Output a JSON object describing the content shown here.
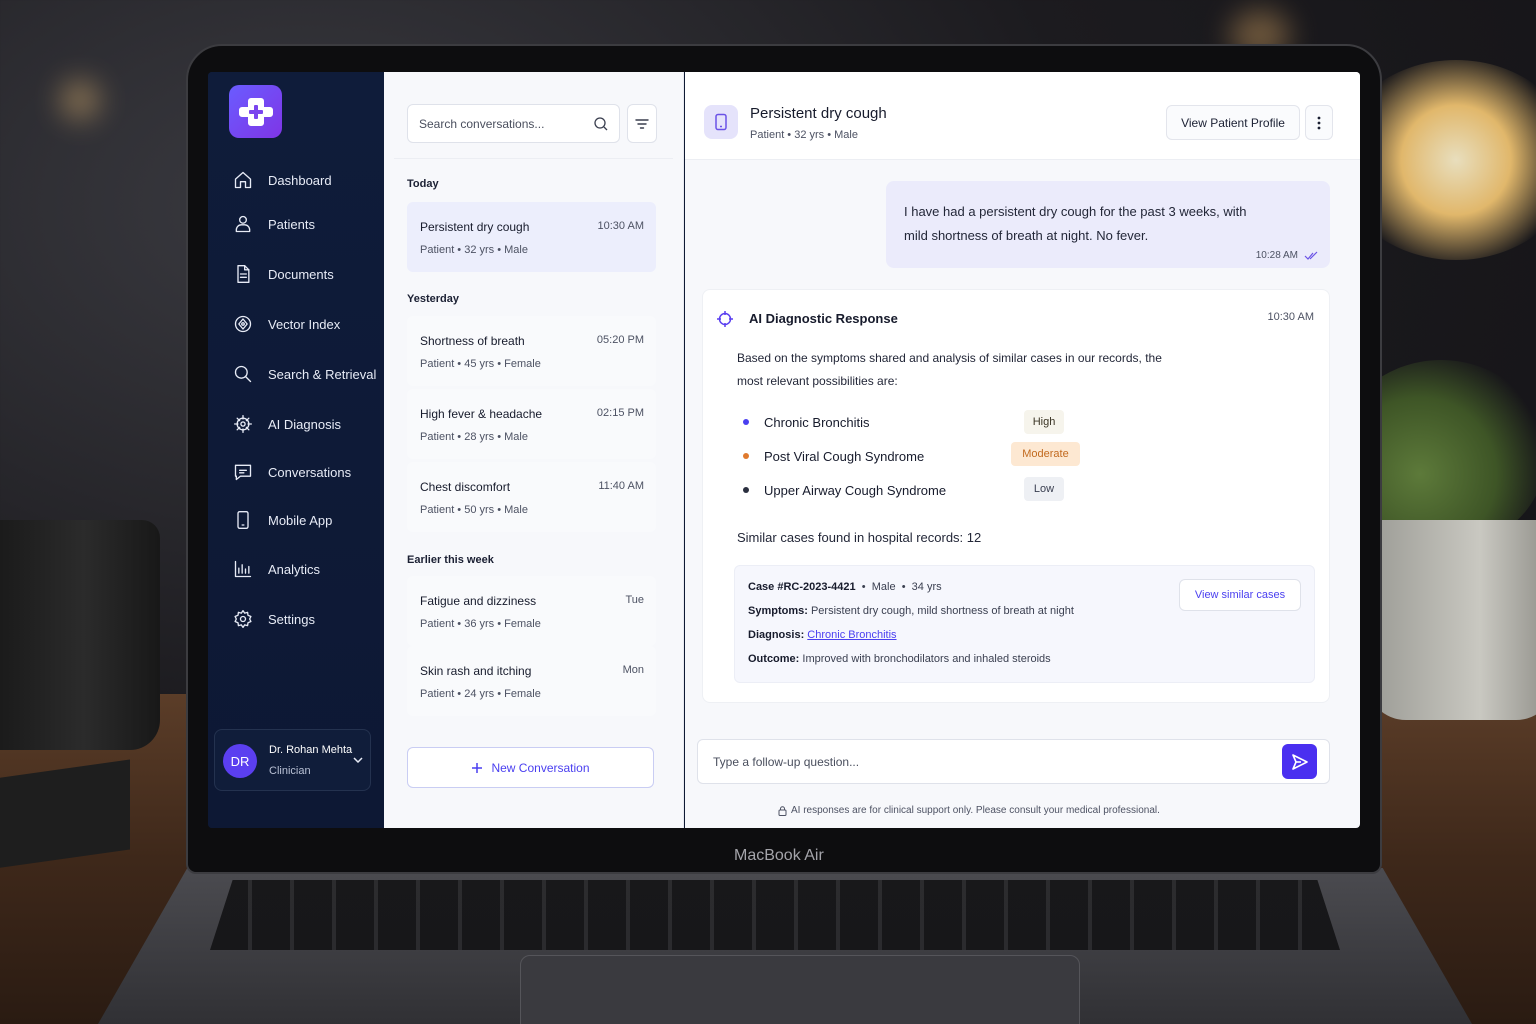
{
  "device": {
    "label": "MacBook Air"
  },
  "sidebar": {
    "items": [
      {
        "label": "Dashboard",
        "icon": "home-icon"
      },
      {
        "label": "Patients",
        "icon": "user-icon"
      },
      {
        "label": "Documents",
        "icon": "document-icon"
      },
      {
        "label": "Vector Index",
        "icon": "vector-icon"
      },
      {
        "label": "Search & Retrieval",
        "icon": "search-icon"
      },
      {
        "label": "AI Diagnosis",
        "icon": "brain-icon"
      },
      {
        "label": "Conversations",
        "icon": "chat-icon"
      },
      {
        "label": "Mobile App",
        "icon": "mobile-icon"
      },
      {
        "label": "Analytics",
        "icon": "chart-icon"
      },
      {
        "label": "Settings",
        "icon": "gear-icon"
      }
    ],
    "user": {
      "initials": "DR",
      "name": "Dr. Rohan Mehta",
      "role": "Clinician"
    }
  },
  "conversations": {
    "search_placeholder": "Search conversations...",
    "groups": [
      {
        "label": "Today",
        "items": [
          {
            "title": "Persistent dry cough",
            "time": "10:30 AM",
            "meta": "Patient • 32 yrs • Male",
            "active": true
          }
        ]
      },
      {
        "label": "Yesterday",
        "items": [
          {
            "title": "Shortness of breath",
            "time": "05:20 PM",
            "meta": "Patient • 45 yrs • Female"
          },
          {
            "title": "High fever & headache",
            "time": "02:15 PM",
            "meta": "Patient • 28 yrs • Male"
          },
          {
            "title": "Chest discomfort",
            "time": "11:40 AM",
            "meta": "Patient • 50 yrs • Male"
          }
        ]
      },
      {
        "label": "Earlier this week",
        "items": [
          {
            "title": "Fatigue and dizziness",
            "time": "Tue",
            "meta": "Patient • 36 yrs • Female"
          },
          {
            "title": "Skin rash and itching",
            "time": "Mon",
            "meta": "Patient • 24 yrs • Female"
          }
        ]
      }
    ],
    "new_button": "New Conversation"
  },
  "chat": {
    "title": "Persistent dry cough",
    "subtitle": "Patient • 32 yrs • Male",
    "view_profile": "View Patient Profile",
    "user_message": {
      "text": "I have had a persistent dry cough for the past 3 weeks, with mild shortness of breath at night. No fever.",
      "time": "10:28 AM"
    },
    "ai": {
      "title": "AI Diagnostic Response",
      "time": "10:30 AM",
      "intro": "Based on the symptoms shared and analysis of similar cases in our records, the most relevant possibilities are:",
      "diagnoses": [
        {
          "name": "Chronic Bronchitis",
          "level": "High",
          "bullet_color": "#4a3ff0",
          "badge_bg": "#f6f4ec",
          "badge_fg": "#3a3424"
        },
        {
          "name": "Post Viral Cough Syndrome",
          "level": "Moderate",
          "bullet_color": "#e07a2e",
          "badge_bg": "#fde8d2",
          "badge_fg": "#c26a1f"
        },
        {
          "name": "Upper Airway Cough Syndrome",
          "level": "Low",
          "bullet_color": "#2a2f3f",
          "badge_bg": "#eef0f4",
          "badge_fg": "#3a3f50"
        }
      ],
      "similar_count": "Similar cases found in hospital records: 12",
      "case": {
        "id": "Case #RC-2023-4421",
        "sex": "Male",
        "age": "34 yrs",
        "symptoms_label": "Symptoms:",
        "symptoms": "Persistent dry cough, mild shortness of breath at night",
        "diagnosis_label": "Diagnosis:",
        "diagnosis": "Chronic Bronchitis",
        "outcome_label": "Outcome:",
        "outcome": "Improved with bronchodilators and inhaled steroids",
        "button": "View similar cases"
      }
    },
    "composer_placeholder": "Type a follow-up question...",
    "disclaimer": "AI responses are for clinical support only. Please consult your medical professional."
  },
  "colors": {
    "accent": "#4a2ff0",
    "sidebar_bg": "#0f1c3a"
  }
}
